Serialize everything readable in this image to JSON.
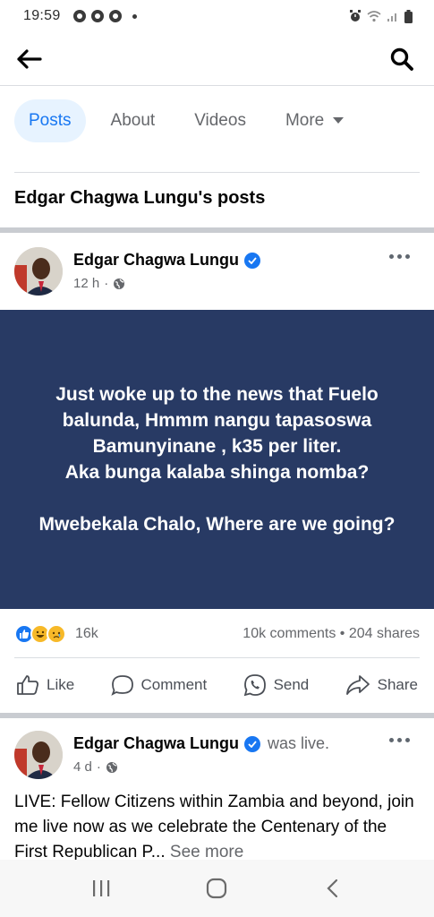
{
  "status_bar": {
    "time": "19:59",
    "notification_icons": [
      "app-icon",
      "app-icon",
      "app-icon"
    ],
    "right_icons": [
      "alarm-icon",
      "wifi-icon",
      "signal-icon",
      "battery-icon"
    ]
  },
  "tabs": [
    {
      "label": "Posts",
      "active": true
    },
    {
      "label": "About",
      "active": false
    },
    {
      "label": "Videos",
      "active": false
    },
    {
      "label": "More",
      "active": false
    }
  ],
  "section_title": "Edgar Chagwa Lungu's posts",
  "posts": [
    {
      "author": "Edgar Chagwa Lungu",
      "time": "12 h",
      "privacy_icon": "globe-icon",
      "text": "Just woke up to the news that Fuelo balunda, Hmmm nangu tapasoswa Bamunyinane , k35 per liter.\nAka bunga kalaba shinga nomba?\n\nMwebekala Chalo, Where are we going?",
      "background_color": "#283a64",
      "reaction_count": "16k",
      "engagement": "10k comments • 204 shares",
      "actions": [
        "Like",
        "Comment",
        "Send",
        "Share"
      ]
    },
    {
      "author": "Edgar Chagwa Lungu",
      "suffix": "was live.",
      "time": "4 d",
      "privacy_icon": "globe-icon",
      "text": "LIVE: Fellow Citizens within Zambia and beyond, join me live now as we celebrate the Centenary of the First Republican P...",
      "see_more": "See more"
    }
  ],
  "colors": {
    "accent": "#1877f2",
    "active_tab_bg": "#e7f3ff",
    "secondary_text": "#65676b"
  }
}
